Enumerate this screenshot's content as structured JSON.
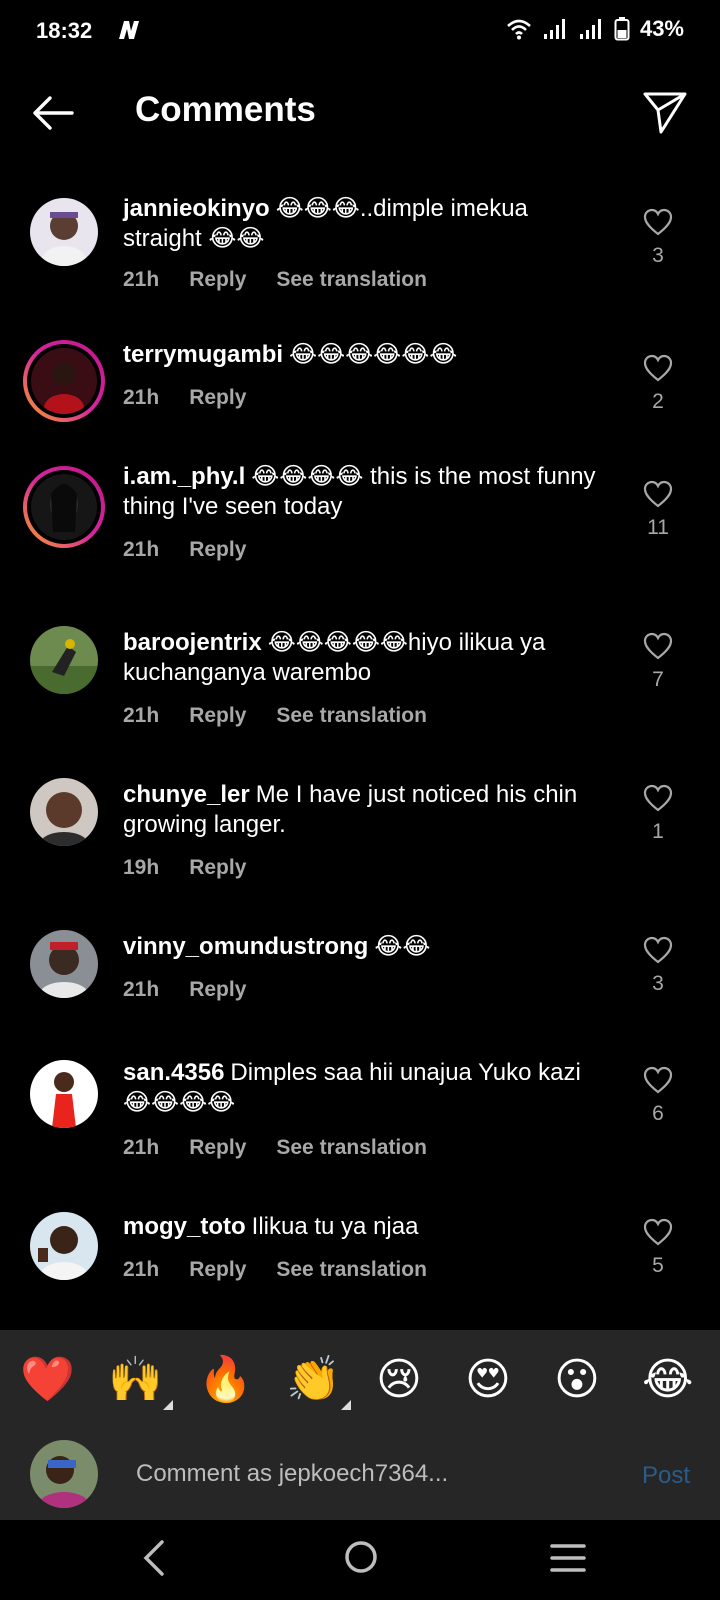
{
  "status": {
    "time": "18:32",
    "battery": "43%"
  },
  "header": {
    "title": "Comments"
  },
  "comments": [
    {
      "username": "jannieokinyo",
      "text": "😂😂😂..dimple imekua straight 😂😂",
      "time": "21h",
      "reply": "Reply",
      "translate": "See translation",
      "likes": "3"
    },
    {
      "username": "terrymugambi",
      "text": "😂😂😂😂😂😂",
      "time": "21h",
      "reply": "Reply",
      "likes": "2"
    },
    {
      "username": "i.am._phy.l",
      "text": "😂😂😂😂 this is the most funny thing I've seen today",
      "time": "21h",
      "reply": "Reply",
      "likes": "11"
    },
    {
      "username": "baroojentrix",
      "text": "😂😂😂😂😂hiyo ilikua ya kuchanganya warembo",
      "time": "21h",
      "reply": "Reply",
      "translate": "See translation",
      "likes": "7"
    },
    {
      "username": "chunye_ler",
      "text": "Me I have just noticed his chin growing langer.",
      "time": "19h",
      "reply": "Reply",
      "likes": "1"
    },
    {
      "username": "vinny_omundustrong",
      "text": "😂😂",
      "time": "21h",
      "reply": "Reply",
      "likes": "3"
    },
    {
      "username": "san.4356",
      "text": "Dimples saa hii unajua Yuko kazi 😂😂😂😂",
      "time": "21h",
      "reply": "Reply",
      "translate": "See translation",
      "likes": "6"
    },
    {
      "username": "mogy_toto",
      "text": "Ilikua tu ya njaa",
      "time": "21h",
      "reply": "Reply",
      "translate": "See translation",
      "likes": "5"
    }
  ],
  "emoji_bar": [
    "❤️",
    "🙌",
    "🔥",
    "👏",
    "😢",
    "😍",
    "😮",
    "😂"
  ],
  "composer": {
    "placeholder": "Comment as jepkoech7364...",
    "post_label": "Post"
  },
  "colors": {
    "background": "#000000",
    "panel": "#262626",
    "secondary_text": "#a8a8a8",
    "post_disabled": "#2b5b8a"
  }
}
